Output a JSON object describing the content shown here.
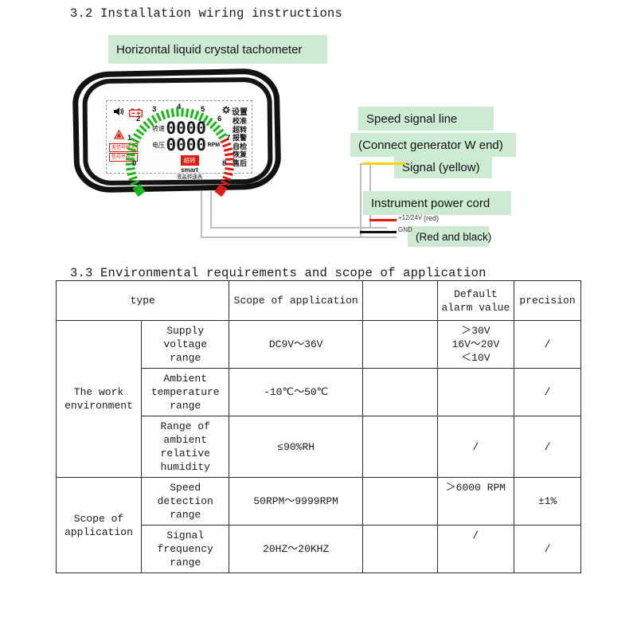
{
  "headings": {
    "s32": "3.2 Installation wiring instructions",
    "s33": "3.3 Environmental requirements and scope of application"
  },
  "callouts": {
    "device_title": "Horizontal liquid crystal tachometer",
    "speed_signal_line": "Speed signal line",
    "connect_generator": "(Connect generator W end)",
    "signal_yellow": "Signal (yellow)",
    "power_cord": "Instrument power cord",
    "red_and_black": "(Red and black)",
    "red_label": "(red)"
  },
  "wires": {
    "positive_label": "+12/24V",
    "ground_label": "GND",
    "yellow_color": "#ffd400",
    "red_color": "#e01b10",
    "black_color": "#111111"
  },
  "lcd": {
    "scale_numbers": [
      "0",
      "1",
      "2",
      "3",
      "4",
      "5",
      "6",
      "7",
      "8"
    ],
    "digit_row_top": "0000",
    "digit_row_bottom": "0000",
    "rpm_unit": "RPM",
    "left_digit_label_top": "转速",
    "left_digit_label_bottom": "电压",
    "brand_red_tag": "超转",
    "brand_name": "smart",
    "brand_cn": "液晶转速表",
    "warning_no_signal": "无信号输入",
    "warning_unstable": "信号不稳定",
    "settings_label": "设置",
    "menu_items": [
      "校准",
      "超转",
      "报警",
      "自检",
      "恢复",
      "售后"
    ],
    "icons": [
      "buzzer-icon",
      "battery-icon",
      "warning-triangle-icon",
      "gear-icon"
    ],
    "green_color": "#16b916",
    "red_color": "#e01b10"
  },
  "table": {
    "headers": {
      "type": "type",
      "scope": "Scope of application",
      "blank": "",
      "alarm": "Default\nalarm value",
      "alarm_line1": "Default",
      "alarm_line2": "alarm value",
      "precision": "precision"
    },
    "groups": [
      {
        "name": "The work\nenvironment",
        "line1": "The work",
        "line2": "environment"
      },
      {
        "name": "Scope of\napplication",
        "line1": "Scope of",
        "line2": "application"
      }
    ],
    "rows": [
      {
        "group": "The work environment",
        "type_line1": "Supply voltage",
        "type_line2": "range",
        "type_line3": "",
        "type_line4": "",
        "scope": "DC9V～36V",
        "alarm_line1": "＞30V",
        "alarm_line2": "16V～20V",
        "alarm_line3": "＜10V",
        "precision": "/"
      },
      {
        "group": "The work environment",
        "type_line1": "Ambient",
        "type_line2": "temperature",
        "type_line3": "range",
        "type_line4": "",
        "scope": "-10℃～50℃",
        "alarm_line1": "",
        "alarm_line2": "",
        "alarm_line3": "",
        "precision": "/"
      },
      {
        "group": "The work environment",
        "type_line1": "Range of",
        "type_line2": "ambient",
        "type_line3": "relative",
        "type_line4": "humidity",
        "scope": "≤90%RH",
        "alarm_line1": "",
        "alarm_line2": "/",
        "alarm_line3": "",
        "precision": "/"
      },
      {
        "group": "Scope of application",
        "type_line1": "Speed",
        "type_line2": "detection",
        "type_line3": "range",
        "type_line4": "",
        "scope": "50RPM～9999RPM",
        "alarm_line1": "＞6000 RPM",
        "alarm_line2": "",
        "alarm_line3": "",
        "precision": "±1%"
      },
      {
        "group": "Scope of application",
        "type_line1": "Signal",
        "type_line2": "frequency",
        "type_line3": "range",
        "type_line4": "",
        "scope": "20HZ～20KHZ",
        "alarm_line1": "/",
        "alarm_line2": "",
        "alarm_line3": "",
        "precision": "/"
      }
    ]
  }
}
